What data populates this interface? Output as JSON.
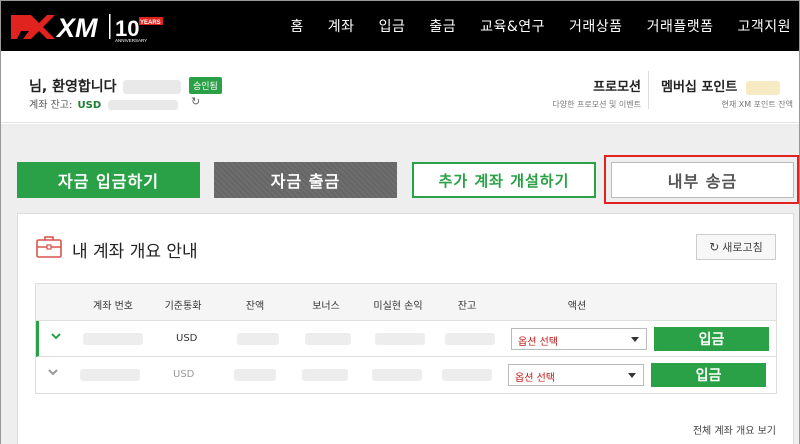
{
  "brand": {
    "anniversary_number": "10",
    "anniversary_label_top": "YEARS",
    "anniversary_label_bottom": "ANNIVERSARY"
  },
  "nav": {
    "items": [
      "홈",
      "계좌",
      "입금",
      "출금",
      "교육&연구",
      "거래상품",
      "거래플랫폼",
      "고객지원"
    ]
  },
  "account": {
    "greeting": "님, 환영합니다",
    "status_badge": "승인됨",
    "balance_label": "계좌 잔고:",
    "balance_currency": "USD"
  },
  "promotions": {
    "title": "프로모션",
    "subtitle": "다양한 프로모션 및 이벤트"
  },
  "membership": {
    "title": "멤버십 포인트",
    "subtitle": "현재 XM 포인트 잔액"
  },
  "actions": {
    "deposit": "자금 입금하기",
    "withdraw": "자금 출금",
    "open_account": "추가 계좌 개설하기",
    "internal_transfer": "내부 송금"
  },
  "overview": {
    "title": "내 계좌 개요 안내",
    "refresh": "새로고침",
    "columns": [
      "계좌 번호",
      "기준통화",
      "잔액",
      "보너스",
      "미실현 손익",
      "잔고",
      "액션"
    ],
    "rows": [
      {
        "currency": "USD",
        "action_select": "옵션 선택",
        "deposit_label": "입금"
      },
      {
        "currency": "USD",
        "action_select": "옵션 선택",
        "deposit_label": "입금"
      }
    ],
    "view_all": "전체 계좌 개요 보기"
  },
  "colors": {
    "brand_green": "#2aa146",
    "highlight_red": "#e0231f",
    "topbar_black": "#000000"
  }
}
